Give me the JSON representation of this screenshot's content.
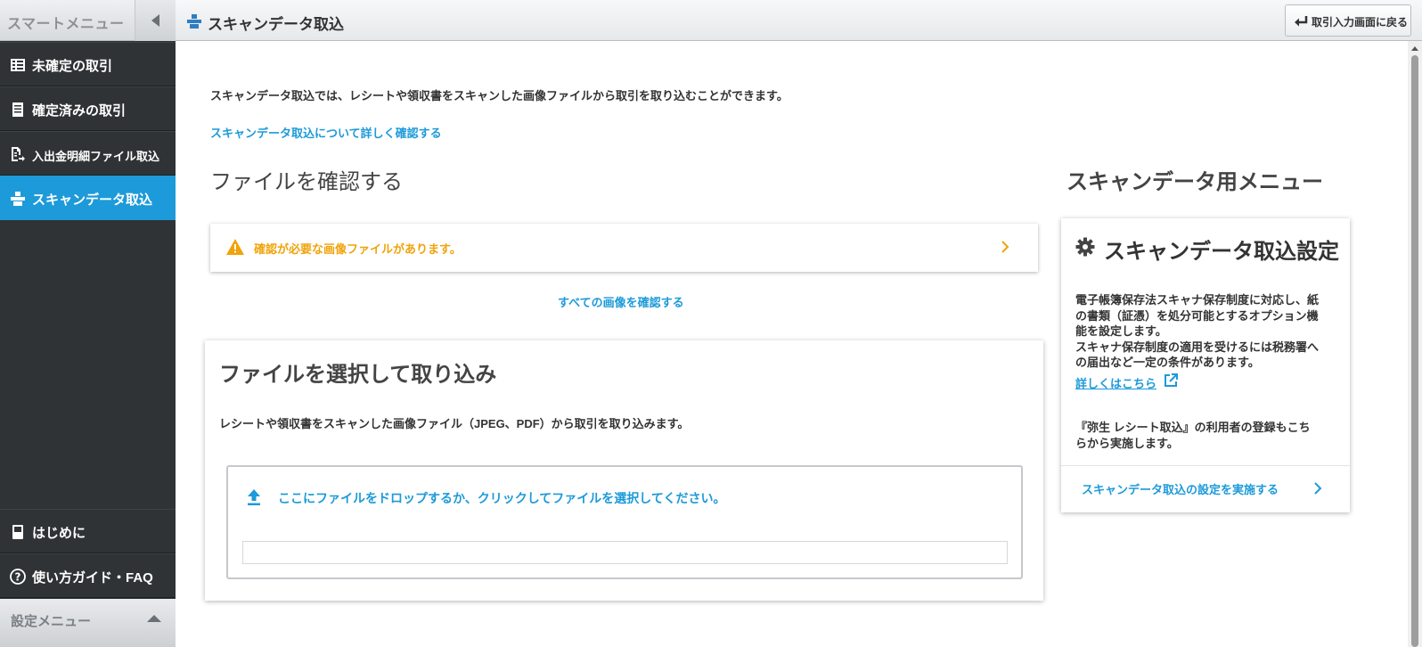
{
  "sidebar": {
    "title": "スマートメニュー",
    "items": [
      {
        "label": "未確定の取引",
        "icon": "ledger-icon"
      },
      {
        "label": "確定済みの取引",
        "icon": "document-icon"
      },
      {
        "label": "入出金明細ファイル取込",
        "icon": "file-import-icon"
      },
      {
        "label": "スキャンデータ取込",
        "icon": "scanner-icon",
        "active": true
      }
    ],
    "bottom_items": [
      {
        "label": "はじめに",
        "icon": "book-icon"
      },
      {
        "label": "使い方ガイド・FAQ",
        "icon": "help-icon"
      }
    ],
    "settings_menu": "設定メニュー"
  },
  "header": {
    "title": "スキャンデータ取込",
    "back_button": "取引入力画面に戻る"
  },
  "main": {
    "intro": "スキャンデータ取込では、レシートや領収書をスキャンした画像ファイルから取引を取り込むことができます。",
    "intro_link": "スキャンデータ取込について詳しく確認する",
    "confirm_heading": "ファイルを確認する",
    "alert": "確認が必要な画像ファイルがあります。",
    "all_images_link": "すべての画像を確認する",
    "import": {
      "heading": "ファイルを選択して取り込み",
      "description": "レシートや領収書をスキャンした画像ファイル（JPEG、PDF）から取引を取り込みます。",
      "dropzone": "ここにファイルをドロップするか、クリックしてファイルを選択してください。",
      "file_value": ""
    }
  },
  "side_menu": {
    "heading": "スキャンデータ用メニュー",
    "card_title": "スキャンデータ取込設定",
    "desc_lines": [
      "電子帳簿保存法スキャナ保存制度に対応し、紙",
      "の書類（証憑）を処分可能とするオプション機",
      "能を設定します。",
      "スキャナ保存制度の適用を受けるには税務署へ",
      "の届出など一定の条件があります。"
    ],
    "detail_link": "詳しくはこちら",
    "note_lines": [
      "『弥生 レシート取込』の利用者の登録もこち",
      "らから実施します。"
    ],
    "action": "スキャンデータ取込の設定を実施する"
  },
  "colors": {
    "accent": "#1d9ad9",
    "warning": "#f0a30a",
    "sidebar_bg": "#2f3336"
  }
}
